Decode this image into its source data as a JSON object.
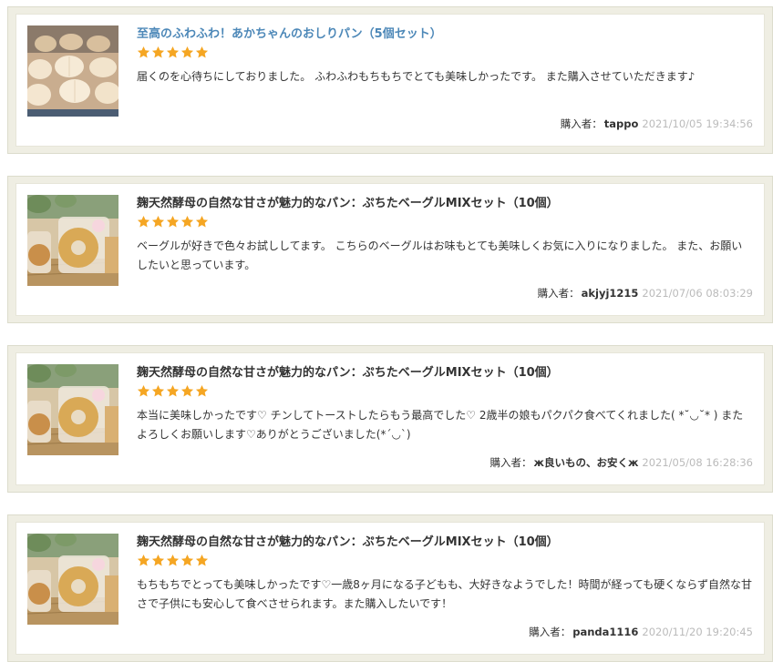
{
  "reviews": [
    {
      "title": "至高のふわふわ！あかちゃんのおしりパン（5個セット）",
      "title_is_link": true,
      "rating": 5,
      "body": "届くのを心待ちにしておりました。 ふわふわもちもちでとても美味しかったです。 また購入させていただきます♪",
      "buyer_label": "購入者：",
      "buyer_name": "tappo",
      "date": "2021/10/05 19:34:56",
      "image": "bread-rolls-photo"
    },
    {
      "title": "麹天然酵母の自然な甘さが魅力的なパン：ぷちたベーグルMIXセット（10個）",
      "title_is_link": false,
      "rating": 5,
      "body": "ベーグルが好きで色々お試ししてます。 こちらのベーグルはお味もとても美味しくお気に入りになりました。 また、お願いしたいと思っています。",
      "buyer_label": "購入者：",
      "buyer_name": "akjyj1215",
      "date": "2021/07/06 08:03:29",
      "image": "bagel-photo"
    },
    {
      "title": "麹天然酵母の自然な甘さが魅力的なパン：ぷちたベーグルMIXセット（10個）",
      "title_is_link": false,
      "rating": 5,
      "body": "本当に美味しかったです♡ チンしてトーストしたらもう最高でした♡ 2歳半の娘もパクパク食べてくれました( *˘◡˘* ) またよろしくお願いします♡ありがとうございました(*´◡`)",
      "buyer_label": "購入者：",
      "buyer_name": "ж良いもの、お安くж",
      "date": "2021/05/08 16:28:36",
      "image": "bagel-photo"
    },
    {
      "title": "麹天然酵母の自然な甘さが魅力的なパン：ぷちたベーグルMIXセット（10個）",
      "title_is_link": false,
      "rating": 5,
      "body": "もちもちでとっても美味しかったです♡一歳8ヶ月になる子どもも、大好きなようでした！時間が経っても硬くならず自然な甘さで子供にも安心して食べさせられます。また購入したいです！",
      "buyer_label": "購入者：",
      "buyer_name": "panda1116",
      "date": "2020/11/20 19:20:45",
      "image": "bagel-photo"
    }
  ],
  "colors": {
    "link": "#4d88b8",
    "star": "#f5a623",
    "card_bg": "#efeee3",
    "date": "#bbbbbb"
  }
}
